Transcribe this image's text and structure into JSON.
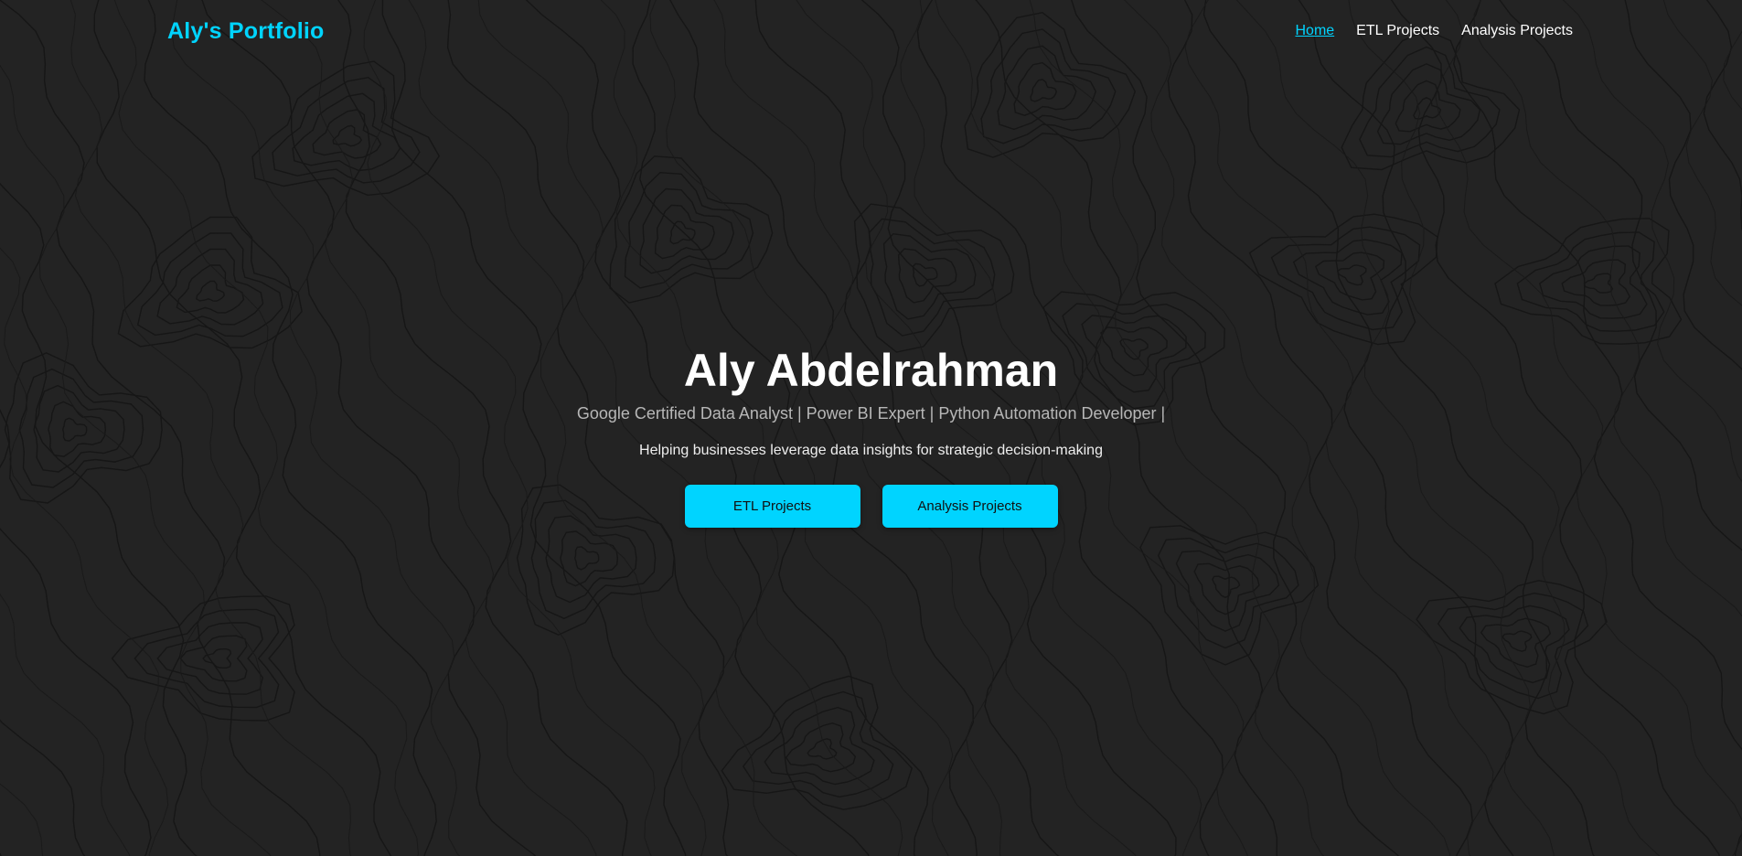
{
  "colors": {
    "accent": "#00d4ff",
    "background": "#232323",
    "text": "#ffffff",
    "subtitle": "#b7b7b7"
  },
  "navbar": {
    "logo": "Aly's Portfolio",
    "links": [
      {
        "label": "Home",
        "active": true
      },
      {
        "label": "ETL Projects",
        "active": false
      },
      {
        "label": "Analysis Projects",
        "active": false
      }
    ]
  },
  "hero": {
    "name": "Aly Abdelrahman",
    "subtitle": "Google Certified Data Analyst | Power BI Expert | Python Automation Developer |",
    "tagline": "Helping businesses leverage data insights for strategic decision-making",
    "buttons": [
      {
        "label": "ETL Projects"
      },
      {
        "label": "Analysis Projects"
      }
    ]
  },
  "background": {
    "pattern": "topographic-contour-lines"
  }
}
